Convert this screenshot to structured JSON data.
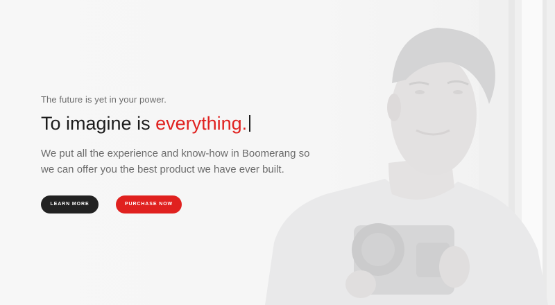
{
  "hero": {
    "eyebrow": "The future is yet in your power.",
    "headline_prefix": "To imagine is ",
    "headline_accent": "everything.",
    "description": "We put all the experience and know-how in Boomerang so we can offer you the best product we have ever built.",
    "accent_color": "#e0211f"
  },
  "buttons": {
    "learn_more": "LEARN MORE",
    "purchase_now": "PURCHASE NOW"
  }
}
